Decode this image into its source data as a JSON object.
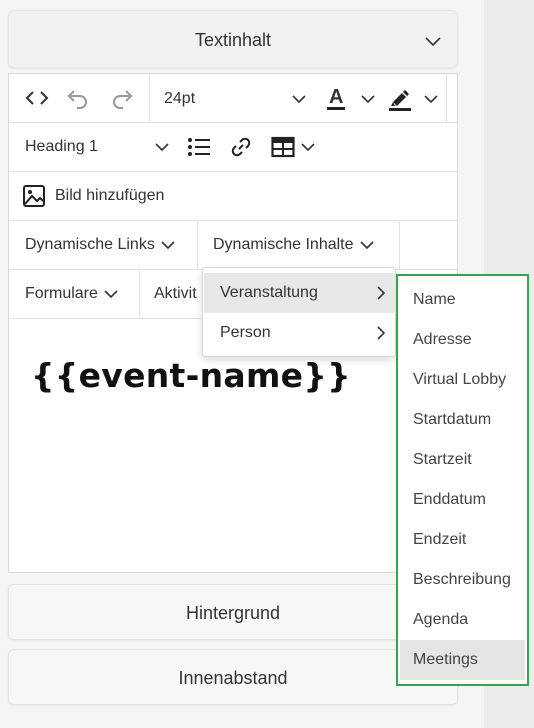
{
  "accordion": {
    "title": "Textinhalt"
  },
  "toolbar": {
    "font_size": "24pt",
    "text_color_letter": "A",
    "heading_select": "Heading 1",
    "add_image_label": "Bild hinzufügen",
    "dynamic_links": "Dynamische Links",
    "dynamic_content": "Dynamische Inhalte",
    "forms": "Formulare",
    "activities": "Aktivit"
  },
  "content": {
    "heading": "{{event-name}}"
  },
  "dynamic_content_menu": {
    "items": [
      {
        "label": "Veranstaltung",
        "active": true
      },
      {
        "label": "Person",
        "active": false
      }
    ]
  },
  "event_submenu": {
    "highlight_color": "#2ea84a",
    "items": [
      "Name",
      "Adresse",
      "Virtual Lobby",
      "Startdatum",
      "Startzeit",
      "Enddatum",
      "Endzeit",
      "Beschreibung",
      "Agenda",
      "Meetings"
    ],
    "active": "Meetings"
  },
  "sections": {
    "background": "Hintergrund",
    "padding": "Innenabstand"
  }
}
